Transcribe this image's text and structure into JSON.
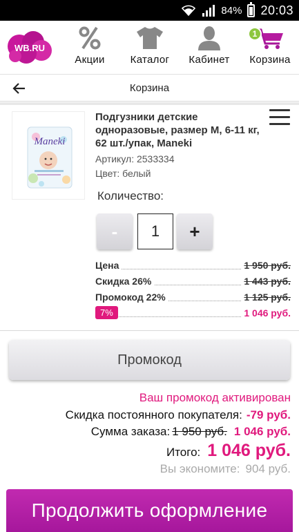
{
  "status_bar": {
    "battery": "84%",
    "time": "20:03"
  },
  "nav": {
    "logo": "WB.RU",
    "items": [
      {
        "label": "Акции",
        "icon": "percent-icon"
      },
      {
        "label": "Каталог",
        "icon": "tshirt-icon"
      },
      {
        "label": "Кабинет",
        "icon": "user-icon"
      },
      {
        "label": "Корзина",
        "icon": "cart-icon",
        "badge": "1"
      }
    ]
  },
  "header": {
    "title": "Корзина"
  },
  "product": {
    "name": "Подгузники детские одноразовые, размер М, 6-11 кг, 62 шт./упак, Maneki",
    "article": "Артикул: 2533334",
    "color": "Цвет: белый",
    "quantity_label": "Количество:",
    "quantity": "1",
    "minus": "-",
    "plus": "+",
    "image_brand": "Maneki"
  },
  "prices": [
    {
      "label": "Цена",
      "value": "1 950 руб.",
      "struck": true
    },
    {
      "label": "Скидка 26%",
      "value": "1 443 руб.",
      "struck": true
    },
    {
      "label": "Промокод 22%",
      "value": "1 125 руб.",
      "struck": true
    },
    {
      "label": "7%",
      "value": "1 046 руб.",
      "struck": false
    }
  ],
  "promo_button": "Промокод",
  "summary": {
    "promo_activated": "Ваш промокод активирован",
    "loyal_label": "Скидка постоянного покупателя:",
    "loyal_value": "-79 руб.",
    "order_label": "Сумма заказа:",
    "order_old": "1 950 руб.",
    "order_new": "1 046 руб.",
    "total_label": "Итого:",
    "total_value": "1 046 руб.",
    "save_label": "Вы экономите:",
    "save_value": "904 руб."
  },
  "continue_button": "Продолжить оформление",
  "colors": {
    "accent": "#e0197d",
    "cta": "#b320a6",
    "badge": "#8dc63f"
  }
}
